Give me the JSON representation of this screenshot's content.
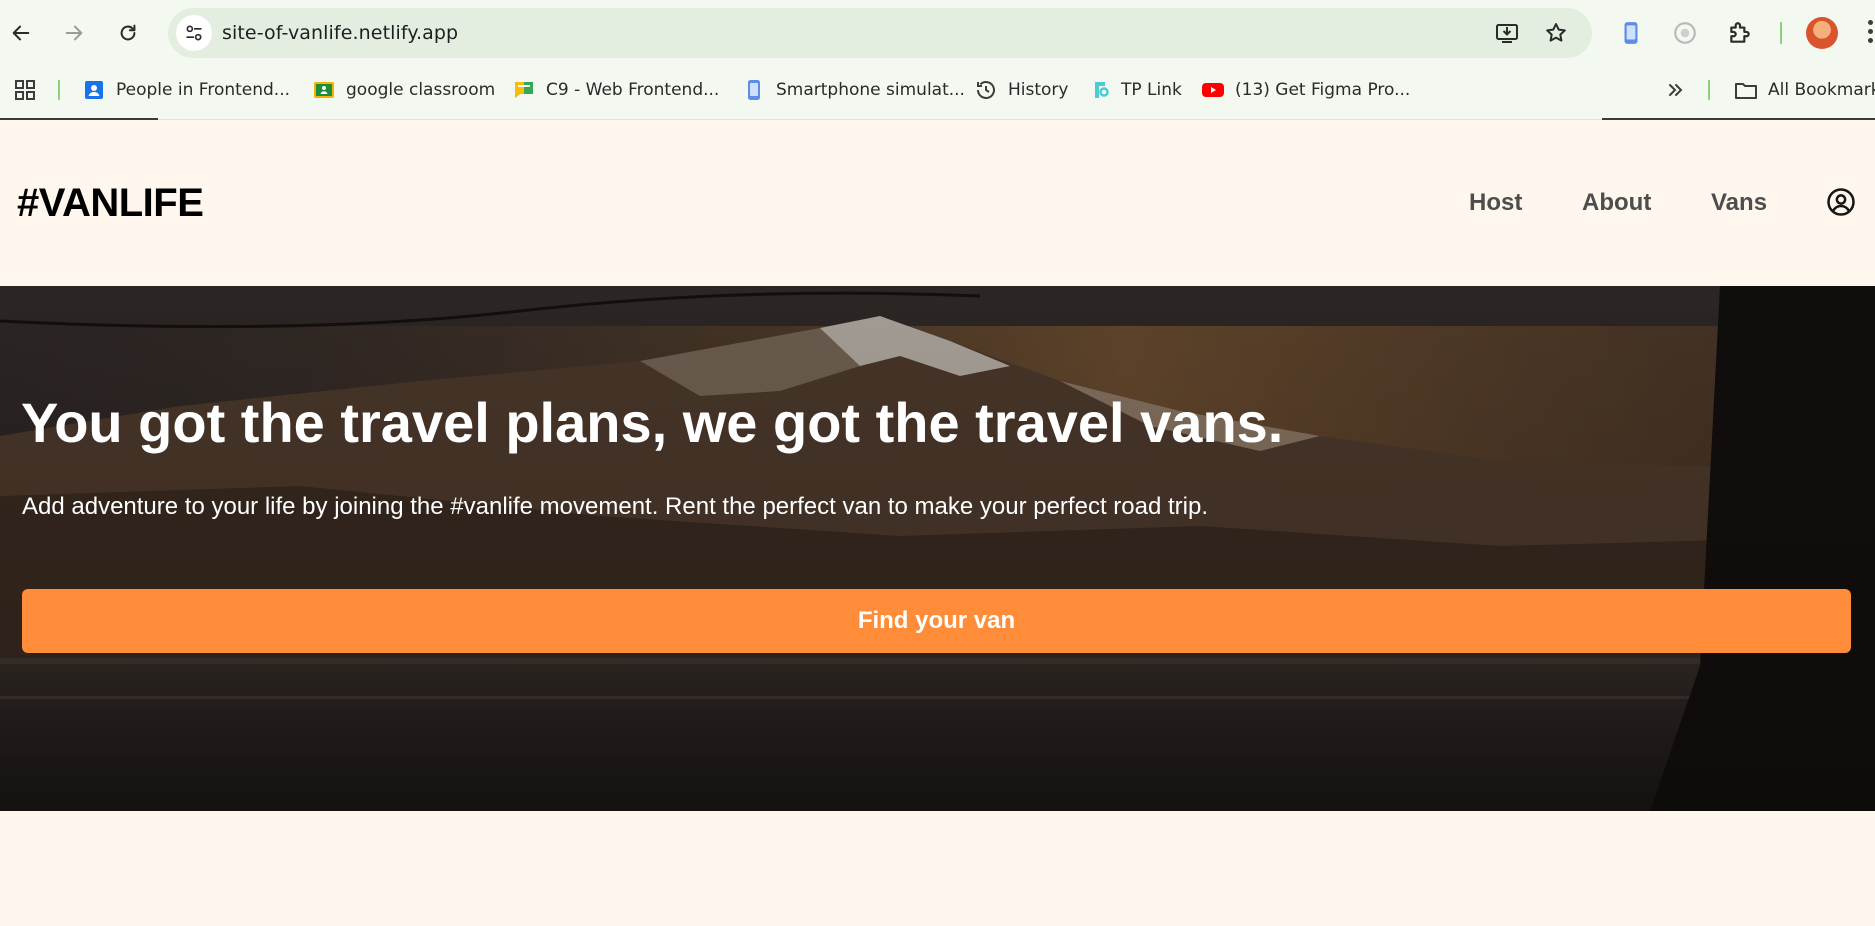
{
  "browser": {
    "url": "site-of-vanlife.netlify.app",
    "bookmarks": [
      {
        "label": "People in Frontend...",
        "icon": "contacts-icon"
      },
      {
        "label": "google classroom",
        "icon": "classroom-icon"
      },
      {
        "label": "C9 - Web Frontend...",
        "icon": "chat-icon"
      },
      {
        "label": "Smartphone simulat...",
        "icon": "phone-icon"
      },
      {
        "label": "History",
        "icon": "history-icon"
      },
      {
        "label": "TP Link",
        "icon": "tplink-icon"
      },
      {
        "label": "(13) Get Figma Pro...",
        "icon": "youtube-icon"
      }
    ],
    "all_bookmarks": "All Bookmarks"
  },
  "site": {
    "logo": "#VANLIFE",
    "nav": [
      {
        "label": "Host"
      },
      {
        "label": "About"
      },
      {
        "label": "Vans"
      }
    ]
  },
  "hero": {
    "title": "You got the travel plans, we got the travel vans.",
    "subtitle": "Add adventure to your life by joining the #vanlife movement. Rent the perfect van to make your perfect road trip.",
    "cta_label": "Find your van"
  },
  "colors": {
    "accent": "#ff8c38",
    "page_bg": "#fff7ed",
    "chrome_bg": "#f3f8f1"
  }
}
